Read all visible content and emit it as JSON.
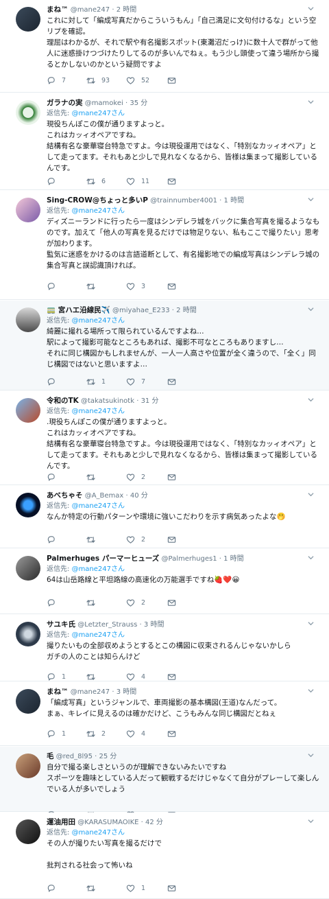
{
  "tweets": [
    {
      "name": "まね™",
      "handle": "@mane247",
      "time": "2 時間",
      "reply_label": "",
      "reply_to": "",
      "text": "これに対して「編成写真だからこういうもん」「自己満足に文句付けるな」という空リプを確認。\n理屈はわかるが、それで駅や有名撮影スポット(東灘沼だっけ)に数十人で群がって他人に迷惑掛けつづけたりしてるのが多いんでねぇ。もう少し頭使って違う場所から撮るとかしないのかという疑問ですよ",
      "reply_count": "7",
      "retweet_count": "93",
      "like_count": "52"
    },
    {
      "name": "ガラナの実",
      "handle": "@mamokei",
      "time": "35 分",
      "reply_label": "返信先: ",
      "reply_to": "@mane247さん",
      "text": "現役ちんぽこの僕が通りますよっと。\nこれはカッィオペアですね。\n結構有名な豪華寝台特急ですよ。今は現役運用ではなく、「特別なカッィオペア」として走ってます。それもあと少しで見れなくなるから、皆様は集まって撮影しているんです。",
      "reply_count": "",
      "retweet_count": "6",
      "like_count": "11"
    },
    {
      "name": "Sing-CROW@ちょっと多いP",
      "handle": "@trainnumber4001",
      "time": "1 時間",
      "reply_label": "返信先: ",
      "reply_to": "@mane247さん",
      "text": "ディズニーランドに行ったら一度はシンデレラ城をバックに集合写真を撮るようなものです。加えて「他人の写真を見るだけでは物足りない、私もここで撮りたい」思考が加わります。\n監気に迷惑をかけるのは言語道断として、有名撮影地での編成写真はシンデレラ城の集合写真と誤認識頂ければ。",
      "reply_count": "",
      "retweet_count": "",
      "like_count": "3"
    },
    {
      "name": "🚃 宮ハエ沿線民✈️",
      "handle": "@miyahae_E233",
      "time": "2 時間",
      "reply_label": "返信先: ",
      "reply_to": "@mane247さん",
      "text": "綺麗に撮れる場所って限られているんですよね…\n駅によって撮影可能なところもあれば、撮影不可なところもありますし…\nそれに同じ構図かもしれませんが、一人一人高さや位置が全く違うので、「全く」同じ構図ではないと思いますよ…",
      "reply_count": "",
      "retweet_count": "1",
      "like_count": "7"
    },
    {
      "name": "令和のTK",
      "handle": "@takatsukinotk",
      "time": "31 分",
      "reply_label": "返信先: ",
      "reply_to": "@mane247さん",
      "text": ".現役ちんぽこの僕が通りますよっと。\nこれはカッィオペアですね。\n結構有名な豪華寝台特急ですよ。今は現役運用ではなく、「特別なカッィオペア」として走ってます。それもあと少しで見れなくなるから、皆様は集まって撮影しているんです。",
      "reply_count": "",
      "retweet_count": "",
      "like_count": "2"
    },
    {
      "name": "あべちゃそ",
      "handle": "@A_Bemax",
      "time": "40 分",
      "reply_label": "返信先: ",
      "reply_to": "@mane247さん",
      "text": "なんか特定の行動パターンや環境に強いこだわりを示す病気あったよな🤭",
      "reply_count": "",
      "retweet_count": "",
      "like_count": "2"
    },
    {
      "name": "Palmerhuges パーマーヒューズ",
      "handle": "@Palmerhuges1",
      "time": "1 時間",
      "reply_label": "返信先: ",
      "reply_to": "@mane247さん",
      "text": "64は山岳路線と平坦路線の高速化の万能選手ですね🍓❤️😀",
      "reply_count": "",
      "retweet_count": "",
      "like_count": "2"
    },
    {
      "name": "サユキ氏",
      "handle": "@Letzter_Strauss",
      "time": "3 時間",
      "reply_label": "返信先: ",
      "reply_to": "@mane247さん",
      "text": "撮りたいもの全部収めようとするとこの構図に収束されるんじゃないかしら\nガチの人のことは知らんけど",
      "reply_count": "1",
      "retweet_count": "",
      "like_count": "4"
    },
    {
      "name": "まね™",
      "handle": "@mane247",
      "time": "3 時間",
      "reply_label": "",
      "reply_to": "",
      "text": "「編成写真」というジャンルで、車両撮影の基本構図(王道)なんだって。\nまぁ、キレイに見えるのは確かだけど、こうもみんな同じ構図だとねぇ",
      "reply_count": "1",
      "retweet_count": "2",
      "like_count": "4"
    },
    {
      "name": "毛",
      "handle": "@red_8l95",
      "time": "25 分",
      "reply_label": "",
      "reply_to": "",
      "text": "自分で撮る楽しさというのが理解できないみたいですね\nスポーツを趣味としている人だって観戦するだけじゃなくて自分がプレーして楽しんでいる人が多いでしょう",
      "reply_count": "",
      "retweet_count": "",
      "like_count": ""
    },
    {
      "name": "運油用田",
      "handle": "@KARASUMAOIKE",
      "time": "42 分",
      "reply_label": "返信先: ",
      "reply_to": "@mane247さん",
      "text": "その人が撮りたい写真を撮るだけで\n\n批判される社会って怖いね",
      "reply_count": "",
      "retweet_count": "",
      "like_count": "1"
    }
  ],
  "colors": {
    "accent": "#1da1f2",
    "muted": "#657786",
    "text": "#14171a",
    "border": "#e6ecf0",
    "gray_bg": "#f5f8fa"
  },
  "icons": {
    "reply": "reply-icon",
    "retweet": "retweet-icon",
    "like": "heart-icon",
    "dm": "mail-icon",
    "menu": "chevron-down-icon"
  }
}
